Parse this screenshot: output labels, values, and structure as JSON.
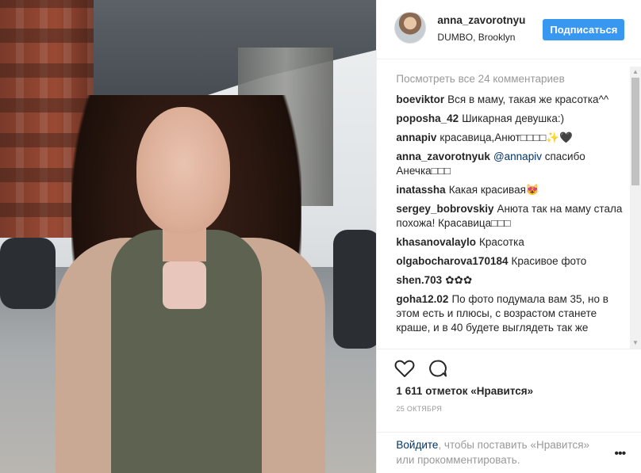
{
  "header": {
    "username": "anna_zavorotnyuk",
    "location": "DUMBO, Brooklyn",
    "follow_label": "Подписаться"
  },
  "comments": {
    "view_all": "Посмотреть все 24 комментариев",
    "items": [
      {
        "user": "boeviktor",
        "text": "Вся в маму, такая же красотка^^"
      },
      {
        "user": "poposha_42",
        "text": "Шикарная девушка:)"
      },
      {
        "user": "annapiv",
        "text": "красавица,Анют□□□□✨🖤"
      },
      {
        "user": "anna_zavorotnyuk",
        "mention": "@annapiv",
        "text": " спасибо Анечка□□□"
      },
      {
        "user": "inatassha",
        "text": "Какая красивая😻"
      },
      {
        "user": "sergey_bobrovskiy",
        "text": "Анюта так на маму стала похожа! Красавица□□□"
      },
      {
        "user": "khasanovalaylo",
        "text": "Красотка"
      },
      {
        "user": "olgabocharova170184",
        "text": "Красивое фото"
      },
      {
        "user": "shen.703",
        "text": "✿✿✿"
      },
      {
        "user": "goha12.02",
        "text": "По фото подумала вам 35, но в этом есть и плюсы, с возрастом станете краше, и в 40 будете выглядеть так же"
      }
    ]
  },
  "actions": {
    "like_icon": "heart-icon",
    "comment_icon": "comment-bubble-icon",
    "likes": "1 611 отметок «Нравится»",
    "date": "25 ОКТЯБРЯ"
  },
  "login": {
    "link": "Войдите",
    "text": ", чтобы поставить «Нравится» или прокомментировать.",
    "more_icon": "more-options-icon"
  },
  "colors": {
    "accent": "#3897f0",
    "link": "#003569",
    "muted": "#999999"
  }
}
